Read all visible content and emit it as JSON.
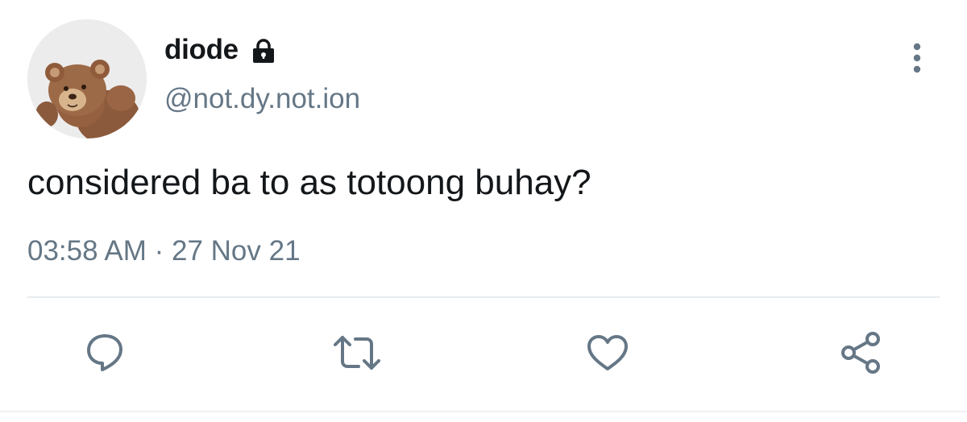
{
  "user": {
    "display_name": "diode",
    "handle": "@not.dy.not.ion",
    "protected_icon": "lock-icon",
    "avatar": "teddy-bear-photo"
  },
  "tweet": {
    "text": "considered ba to as totoong buhay?",
    "time": "03:58 AM",
    "separator": " · ",
    "date": "27 Nov 21"
  },
  "icons": {
    "more": "more-vertical-icon",
    "reply": "reply-icon",
    "retweet": "retweet-icon",
    "like": "heart-icon",
    "share": "share-icon"
  },
  "colors": {
    "text_primary": "#14171a",
    "text_secondary": "#657786",
    "icon": "#657786",
    "divider": "#e6ecf0"
  }
}
